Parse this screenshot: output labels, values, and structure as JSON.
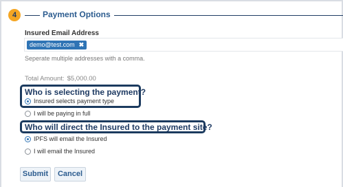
{
  "section": {
    "step": "4",
    "title": "Payment Options"
  },
  "email": {
    "label": "Insured Email Address",
    "tags": [
      "demo@test.com"
    ],
    "remove_glyph": "✖",
    "help": "Seperate multiple addresses with a comma."
  },
  "total": {
    "label": "Total Amount:",
    "value": "$5,000.00"
  },
  "q1": {
    "question": "Who is selecting the payment?",
    "options": [
      {
        "label": "Insured selects payment type",
        "checked": true
      },
      {
        "label": "I will be paying in full",
        "checked": false
      }
    ]
  },
  "q2": {
    "question": "Who will direct the Insured to the payment site?",
    "options": [
      {
        "label": "IPFS will email the Insured",
        "checked": true
      },
      {
        "label": "I will email the Insured",
        "checked": false
      }
    ]
  },
  "buttons": {
    "submit": "Submit",
    "cancel": "Cancel"
  },
  "colors": {
    "accent": "#2f74b5",
    "badge": "#f5a623",
    "navy": "#1f3b63"
  }
}
